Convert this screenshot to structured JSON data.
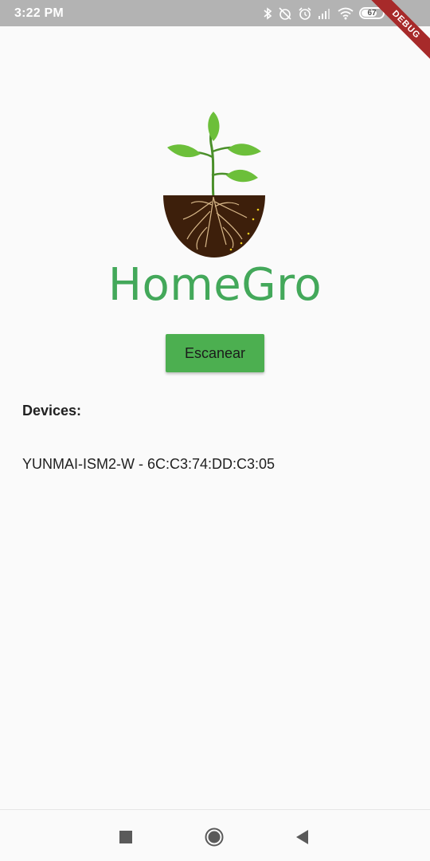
{
  "status_bar": {
    "time": "3:22 PM",
    "battery_level": "67",
    "battery_fraction": 0.67,
    "icons": [
      "bluetooth-icon",
      "alarm-off-icon",
      "alarm-icon",
      "signal-icon",
      "wifi-icon",
      "battery-icon",
      "charging-icon"
    ]
  },
  "debug_banner": {
    "label": "DEBUG",
    "color": "#a72a2a"
  },
  "app": {
    "title": "HomeGro",
    "title_color": "#43a85a",
    "logo_icon": "plant-logo-icon"
  },
  "scan_button": {
    "label": "Escanear",
    "color": "#4caf50"
  },
  "devices": {
    "heading": "Devices:",
    "items": [
      {
        "label": "YUNMAI-ISM2-W - 6C:C3:74:DD:C3:05"
      }
    ]
  },
  "nav_bar": {
    "buttons": [
      "recent-apps-icon",
      "home-icon",
      "back-icon"
    ]
  }
}
